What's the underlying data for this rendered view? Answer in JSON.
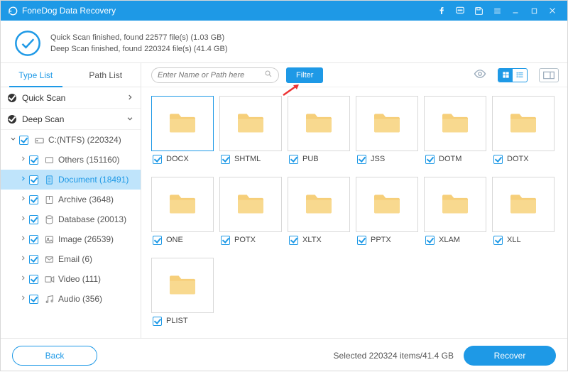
{
  "app": {
    "title": "FoneDog Data Recovery"
  },
  "status": {
    "line1": "Quick Scan finished, found 22577 file(s) (1.03 GB)",
    "line2": "Deep Scan finished, found 220324 file(s) (41.4 GB)"
  },
  "tabs": {
    "type_list": "Type List",
    "path_list": "Path List"
  },
  "search": {
    "placeholder": "Enter Name or Path here"
  },
  "toolbar": {
    "filter": "Filter"
  },
  "sections": {
    "quick_scan": "Quick Scan",
    "deep_scan": "Deep Scan"
  },
  "tree": {
    "drive": "C:(NTFS) (220324)",
    "children": [
      {
        "label": "Others (151160)",
        "icon": "others"
      },
      {
        "label": "Document (18491)",
        "icon": "document",
        "selected": true
      },
      {
        "label": "Archive (3648)",
        "icon": "archive"
      },
      {
        "label": "Database (20013)",
        "icon": "database"
      },
      {
        "label": "Image (26539)",
        "icon": "image"
      },
      {
        "label": "Email (6)",
        "icon": "email"
      },
      {
        "label": "Video (111)",
        "icon": "video"
      },
      {
        "label": "Audio (356)",
        "icon": "audio"
      }
    ]
  },
  "grid": [
    {
      "name": "DOCX",
      "selected": true
    },
    {
      "name": "SHTML"
    },
    {
      "name": "PUB"
    },
    {
      "name": "JSS"
    },
    {
      "name": "DOTM"
    },
    {
      "name": "DOTX"
    },
    {
      "name": "ONE"
    },
    {
      "name": "POTX"
    },
    {
      "name": "XLTX"
    },
    {
      "name": "PPTX"
    },
    {
      "name": "XLAM"
    },
    {
      "name": "XLL"
    },
    {
      "name": "PLIST"
    }
  ],
  "footer": {
    "back": "Back",
    "selected": "Selected 220324 items/41.4 GB",
    "recover": "Recover"
  }
}
